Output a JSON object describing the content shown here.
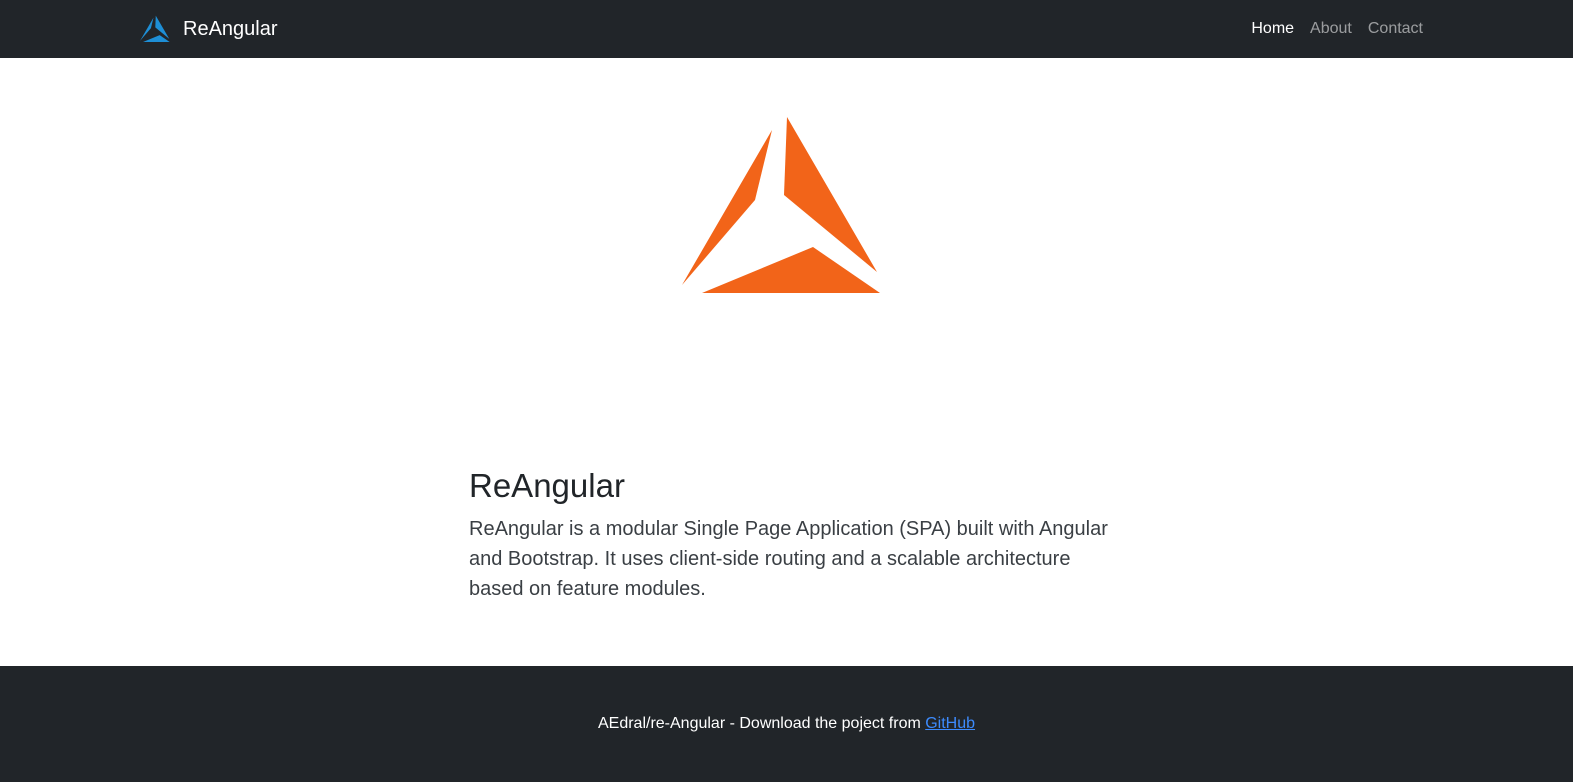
{
  "navbar": {
    "brand": "ReAngular",
    "brand_logo_icon": "reangular-logo-icon",
    "links": [
      {
        "label": "Home",
        "active": true
      },
      {
        "label": "About",
        "active": false
      },
      {
        "label": "Contact",
        "active": false
      }
    ]
  },
  "hero": {
    "logo_icon": "reangular-logo-icon",
    "title": "ReAngular",
    "description": "ReAngular is a modular Single Page Application (SPA) built with Angular and Bootstrap. It uses client-side routing and a scalable architecture based on feature modules."
  },
  "footer": {
    "text": "AEdral/re-Angular - Download the poject from",
    "link_label": "GitHub"
  },
  "colors": {
    "navbar_bg": "#212529",
    "brand_logo": "#1e8fd6",
    "hero_logo": "#f26419",
    "link": "#3d8bfd"
  }
}
